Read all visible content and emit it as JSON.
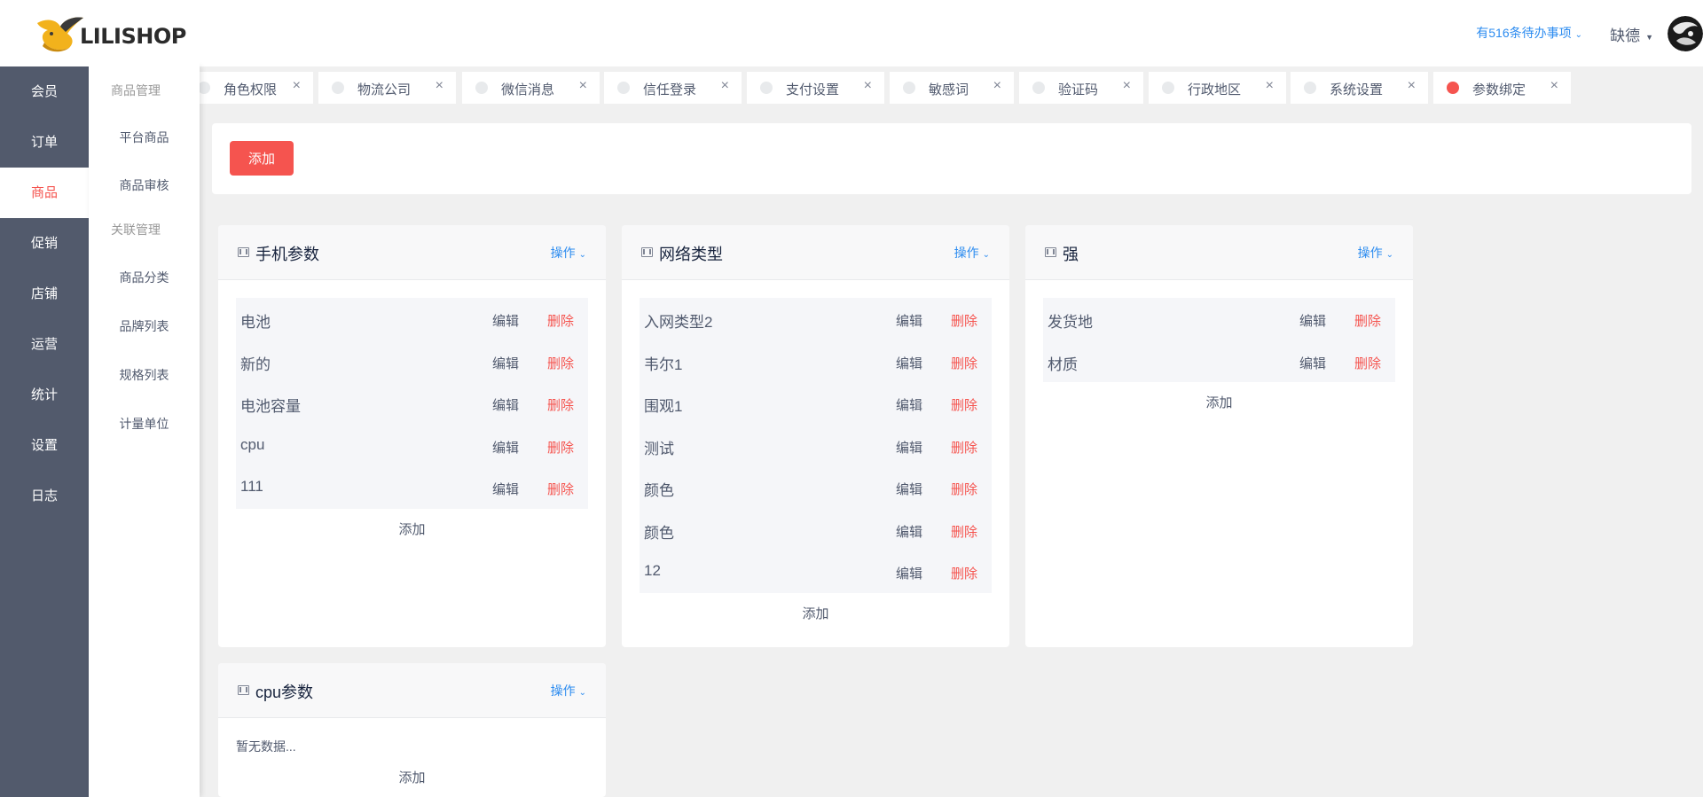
{
  "logo": {
    "text": "LILISHOP"
  },
  "rail": {
    "items": [
      {
        "label": "会员"
      },
      {
        "label": "订单"
      },
      {
        "label": "商品"
      },
      {
        "label": "促销"
      },
      {
        "label": "店铺"
      },
      {
        "label": "运营"
      },
      {
        "label": "统计"
      },
      {
        "label": "设置"
      },
      {
        "label": "日志"
      }
    ]
  },
  "submenu": {
    "group1": "商品管理",
    "item_platform": "平台商品",
    "item_review": "商品审核",
    "group2": "关联管理",
    "item_category": "商品分类",
    "item_brand": "品牌列表",
    "item_spec": "规格列表",
    "item_unit": "计量单位"
  },
  "header": {
    "todo": "有516条待办事项",
    "user": "缺德"
  },
  "tabs": [
    {
      "label": "角色权限"
    },
    {
      "label": "物流公司"
    },
    {
      "label": "微信消息"
    },
    {
      "label": "信任登录"
    },
    {
      "label": "支付设置"
    },
    {
      "label": "敏感词"
    },
    {
      "label": "验证码"
    },
    {
      "label": "行政地区"
    },
    {
      "label": "系统设置"
    },
    {
      "label": "参数绑定"
    }
  ],
  "toolbar": {
    "add_label": "添加"
  },
  "common": {
    "ops_label": "操作",
    "edit_label": "编辑",
    "delete_label": "删除",
    "add_label": "添加",
    "empty_text": "暂无数据..."
  },
  "cards": [
    {
      "title": "手机参数",
      "items": [
        "电池",
        "新的",
        "电池容量",
        "cpu",
        "111"
      ]
    },
    {
      "title": "网络类型",
      "items": [
        "入网类型2",
        "韦尔1",
        "围观1",
        "测试",
        "颜色",
        "颜色",
        "12"
      ]
    },
    {
      "title": "强",
      "items": [
        "发货地",
        "材质"
      ]
    },
    {
      "title": "cpu参数",
      "items": []
    }
  ],
  "colors": {
    "accent": "#f5544f",
    "link": "#2d8cf0",
    "rail_bg": "#525a6c"
  }
}
